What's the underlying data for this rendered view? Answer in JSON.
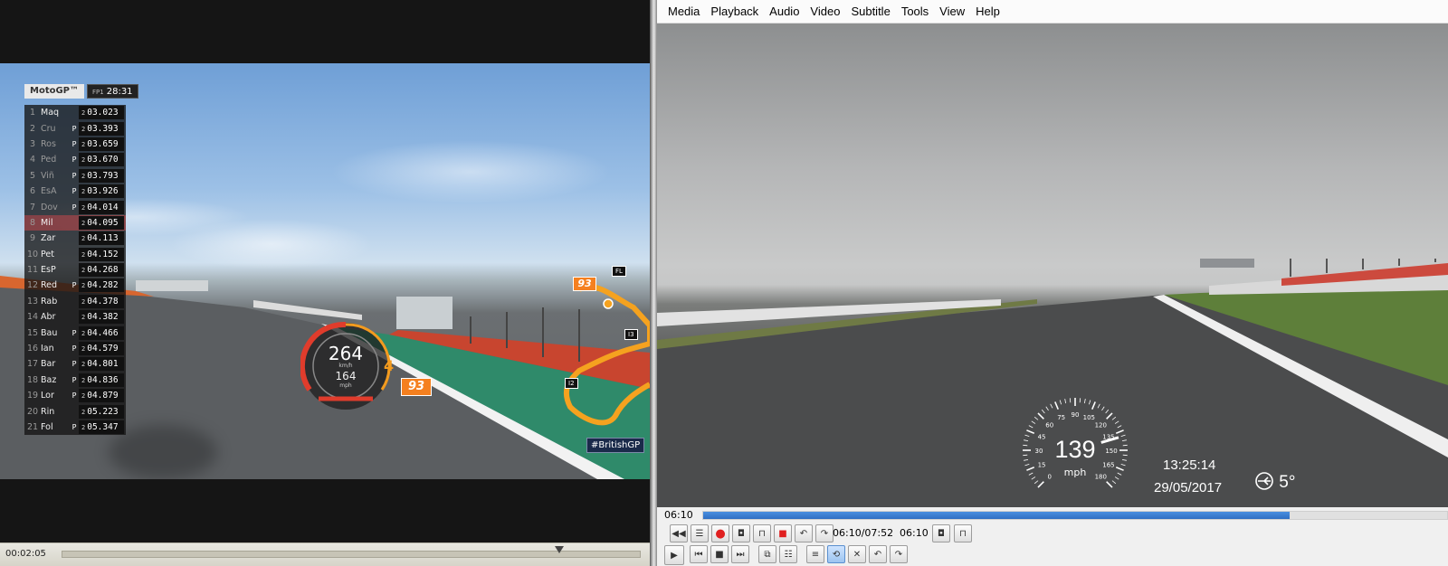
{
  "left_player": {
    "leaderboard": {
      "brand": "MotoGP™",
      "session_label": "FP1",
      "session_time": "28:31",
      "rows": [
        {
          "pos": "1",
          "name": "Maq",
          "pit": "",
          "lap": "2",
          "time": "03.023"
        },
        {
          "pos": "2",
          "name": "Cru",
          "pit": "P",
          "lap": "2",
          "time": "03.393"
        },
        {
          "pos": "3",
          "name": "Ros",
          "pit": "P",
          "lap": "2",
          "time": "03.659"
        },
        {
          "pos": "4",
          "name": "Ped",
          "pit": "P",
          "lap": "2",
          "time": "03.670"
        },
        {
          "pos": "5",
          "name": "Viñ",
          "pit": "P",
          "lap": "2",
          "time": "03.793"
        },
        {
          "pos": "6",
          "name": "EsA",
          "pit": "P",
          "lap": "2",
          "time": "03.926"
        },
        {
          "pos": "7",
          "name": "Dov",
          "pit": "P",
          "lap": "2",
          "time": "04.014"
        },
        {
          "pos": "8",
          "name": "Mil",
          "pit": "",
          "lap": "2",
          "time": "04.095"
        },
        {
          "pos": "9",
          "name": "Zar",
          "pit": "",
          "lap": "2",
          "time": "04.113"
        },
        {
          "pos": "10",
          "name": "Pet",
          "pit": "",
          "lap": "2",
          "time": "04.152"
        },
        {
          "pos": "11",
          "name": "EsP",
          "pit": "",
          "lap": "2",
          "time": "04.268"
        },
        {
          "pos": "12",
          "name": "Red",
          "pit": "P",
          "lap": "2",
          "time": "04.282"
        },
        {
          "pos": "13",
          "name": "Rab",
          "pit": "",
          "lap": "2",
          "time": "04.378"
        },
        {
          "pos": "14",
          "name": "Abr",
          "pit": "",
          "lap": "2",
          "time": "04.382"
        },
        {
          "pos": "15",
          "name": "Bau",
          "pit": "P",
          "lap": "2",
          "time": "04.466"
        },
        {
          "pos": "16",
          "name": "Ian",
          "pit": "P",
          "lap": "2",
          "time": "04.579"
        },
        {
          "pos": "17",
          "name": "Bar",
          "pit": "P",
          "lap": "2",
          "time": "04.801"
        },
        {
          "pos": "18",
          "name": "Baz",
          "pit": "P",
          "lap": "2",
          "time": "04.836"
        },
        {
          "pos": "19",
          "name": "Lor",
          "pit": "P",
          "lap": "2",
          "time": "04.879"
        },
        {
          "pos": "20",
          "name": "Rin",
          "pit": "",
          "lap": "2",
          "time": "05.223"
        },
        {
          "pos": "21",
          "name": "Fol",
          "pit": "P",
          "lap": "2",
          "time": "05.347"
        }
      ]
    },
    "gauge": {
      "speed_kmh": "264",
      "unit_kmh": "km/h",
      "speed_mph": "164",
      "unit_mph": "mph",
      "gear": "4"
    },
    "rider_number": "93",
    "map_markers": {
      "fl": "FL",
      "i2": "I2",
      "i3": "I3"
    },
    "hashtag": "#BritishGP",
    "elapsed": "00:02:05",
    "seek_fraction": 0.858
  },
  "right_player": {
    "menu": [
      "Media",
      "Playback",
      "Audio",
      "Video",
      "Subtitle",
      "Tools",
      "View",
      "Help"
    ],
    "overlay": {
      "speed": "139",
      "speed_unit": "mph",
      "scale": [
        "0",
        "15",
        "30",
        "45",
        "60",
        "75",
        "90",
        "105",
        "120",
        "135",
        "150",
        "165",
        "180"
      ],
      "clock": "13:25:14",
      "date": "29/05/2017",
      "temperature": "5°"
    },
    "elapsed": "06:10",
    "position_text": "06:10/07:52",
    "ab_time": "06:10",
    "seek_fraction": 0.7886
  },
  "colors": {
    "accent_orange": "#f5801f",
    "seek_blue": "#2f6fc2",
    "record_red": "#e02020"
  }
}
